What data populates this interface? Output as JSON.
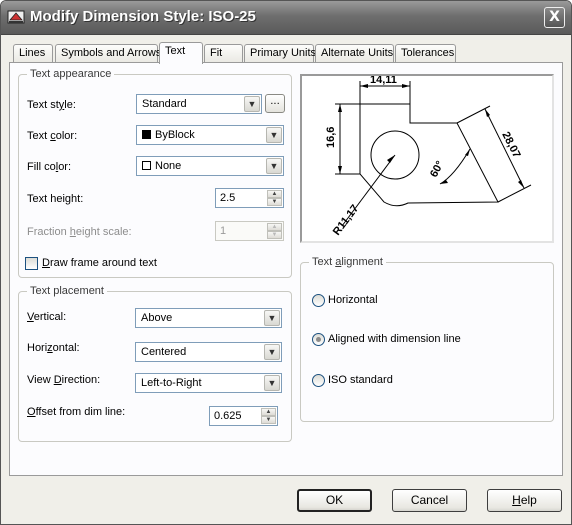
{
  "title": "Modify Dimension Style: ISO-25",
  "close_label": "X",
  "tabs": [
    {
      "label": "Lines"
    },
    {
      "label": "Symbols and Arrows"
    },
    {
      "label": "Text",
      "active": true
    },
    {
      "label": "Fit"
    },
    {
      "label": "Primary Units"
    },
    {
      "label": "Alternate Units"
    },
    {
      "label": "Tolerances"
    }
  ],
  "text_appearance": {
    "legend": "Text appearance",
    "text_style": {
      "label_pre": "Text st",
      "label_u": "y",
      "label_post": "le:",
      "value": "Standard",
      "browse": "..."
    },
    "text_color": {
      "label_pre": "Text ",
      "label_u": "c",
      "label_post": "olor:",
      "value": "ByBlock",
      "swatch": "#000000"
    },
    "fill_color": {
      "label_pre": "Fill co",
      "label_u": "l",
      "label_post": "or:",
      "value": "None",
      "swatch": "#ffffff"
    },
    "text_height": {
      "label_pre": "Text hei",
      "label_u": "g",
      "label_post": "ht:",
      "value": "2.5"
    },
    "fraction_height": {
      "label_pre": "Fraction ",
      "label_u": "h",
      "label_post": "eight scale:",
      "value": "1"
    },
    "draw_frame": {
      "label_pre": "",
      "label_u": "D",
      "label_post": "raw frame around text",
      "checked": false
    }
  },
  "text_placement": {
    "legend": "Text placement",
    "vertical": {
      "label_pre": "",
      "label_u": "V",
      "label_post": "ertical:",
      "value": "Above"
    },
    "horizontal": {
      "label_pre": "Hori",
      "label_u": "z",
      "label_post": "ontal:",
      "value": "Centered"
    },
    "view_direction": {
      "label_pre": "View ",
      "label_u": "D",
      "label_post": "irection:",
      "value": "Left-to-Right"
    },
    "offset": {
      "label_pre": "",
      "label_u": "O",
      "label_post": "ffset from dim line:",
      "value": "0.625"
    }
  },
  "preview": {
    "dim_top": "14,11",
    "dim_left": "16,6",
    "dim_right": "28,07",
    "dim_angle": "60°",
    "dim_radius": "R11,17"
  },
  "text_alignment": {
    "legend_pre": "Text ",
    "legend_u": "a",
    "legend_post": "lignment",
    "options": [
      {
        "label": "Horizontal",
        "checked": false
      },
      {
        "label": "Aligned with dimension line",
        "checked": true
      },
      {
        "label": "ISO standard",
        "checked": false
      }
    ]
  },
  "buttons": {
    "ok": "OK",
    "cancel": "Cancel",
    "help_u": "H",
    "help_post": "elp"
  }
}
